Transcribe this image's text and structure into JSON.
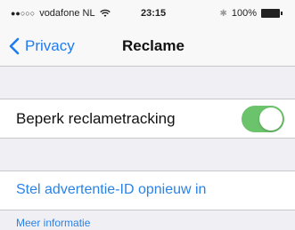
{
  "status_bar": {
    "signal_dots": "●●○○○",
    "carrier": "vodafone NL",
    "time": "23:15",
    "battery": "100%",
    "icons": [
      "wifi-icon",
      "bluetooth-icon",
      "battery-icon"
    ]
  },
  "nav": {
    "back_label": "Privacy",
    "title": "Reclame"
  },
  "settings": {
    "limit_tracking_label": "Beperk reclametracking",
    "limit_tracking_on": true,
    "reset_id_label": "Stel advertentie-ID opnieuw in",
    "more_info_label": "Meer informatie"
  },
  "colors": {
    "accent": "#1e7cf2",
    "toggle_on": "#6bc36b",
    "background": "#efeff4"
  }
}
